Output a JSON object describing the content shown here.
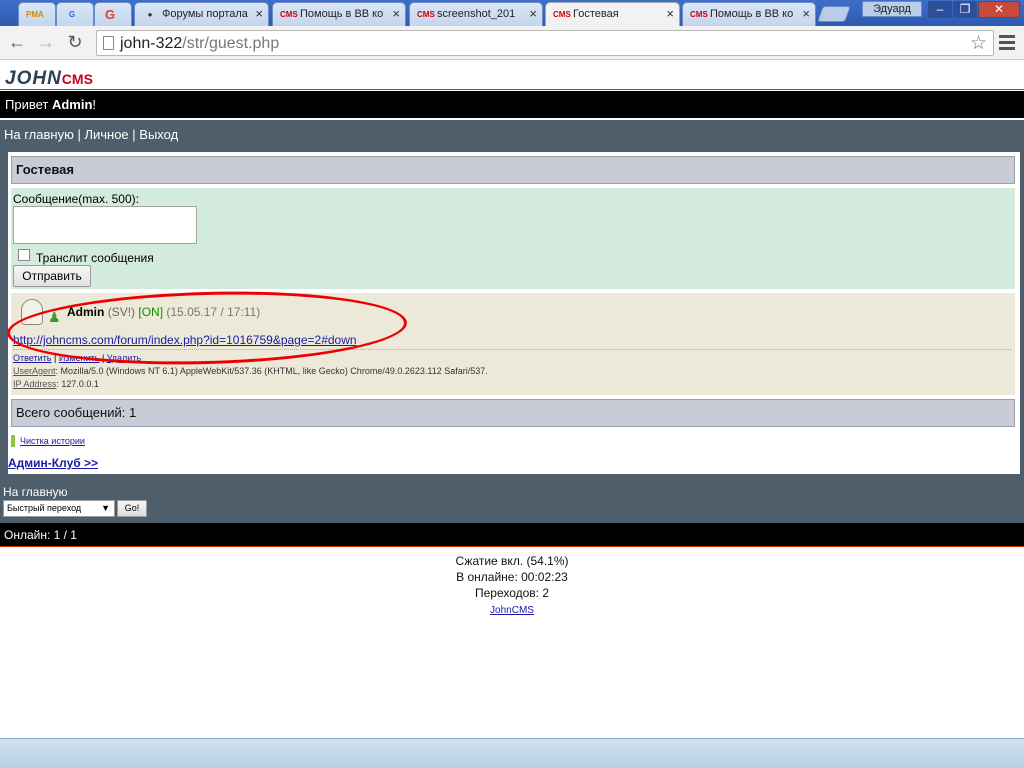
{
  "browser": {
    "tabs": [
      {
        "icon": "PMA",
        "title": ""
      },
      {
        "icon": "G",
        "title": ""
      },
      {
        "icon": "G",
        "title": ""
      },
      {
        "icon": "forum",
        "title": "Форумы портала"
      },
      {
        "icon": "CMS",
        "title": "Помощь в ВВ ко"
      },
      {
        "icon": "CMS",
        "title": "screenshot_201"
      },
      {
        "icon": "CMS",
        "title": "Гостевая"
      },
      {
        "icon": "CMS",
        "title": "Помощь в ВВ ко"
      }
    ],
    "user_name": "Эдуард",
    "url_host": "john-322",
    "url_path": "/str/guest.php"
  },
  "site": {
    "logo_main": "JOHN",
    "logo_sub": "CMS",
    "greeting_prefix": "Привет ",
    "greeting_user": "Admin",
    "greeting_suffix": "!",
    "nav": [
      "На главную",
      "Личное",
      "Выход"
    ],
    "nav_separator": " | "
  },
  "guestbook": {
    "header": "Гостевая",
    "message_label": "Сообщение(max. 500):",
    "translit_label": "Транслит сообщения",
    "submit_label": "Отправить",
    "post": {
      "nick": "Admin",
      "status": "(SV!)",
      "online": "[ON]",
      "time": "(15.05.17 / 17:11)",
      "text": "http://johncms.com/forum/index.php?id=1016759&page=2#down",
      "actions": [
        "Ответить",
        "Изменить",
        "Удалить"
      ],
      "useragent_label": "UserAgent",
      "useragent_value": ": Mozilla/5.0 (Windows NT 6.1) AppleWebKit/537.36 (KHTML, like Gecko) Chrome/49.0.2623.112 Safari/537.",
      "ip_label": "IP Address",
      "ip_value": ": 127.0.0.1"
    },
    "total_label": "Всего сообщений: 1",
    "clear_history": "Чистка истории",
    "admin_club": "Админ-Клуб >>"
  },
  "footer": {
    "home_link": "На главную",
    "quick_jump": "Быстрый переход",
    "go_button": "Go!",
    "online": "Онлайн: 1 / 1",
    "stats": [
      "Сжатие вкл. (54.1%)",
      "В онлайне: 00:02:23",
      "Переходов: 2"
    ],
    "cms_link": "JohnCMS"
  }
}
